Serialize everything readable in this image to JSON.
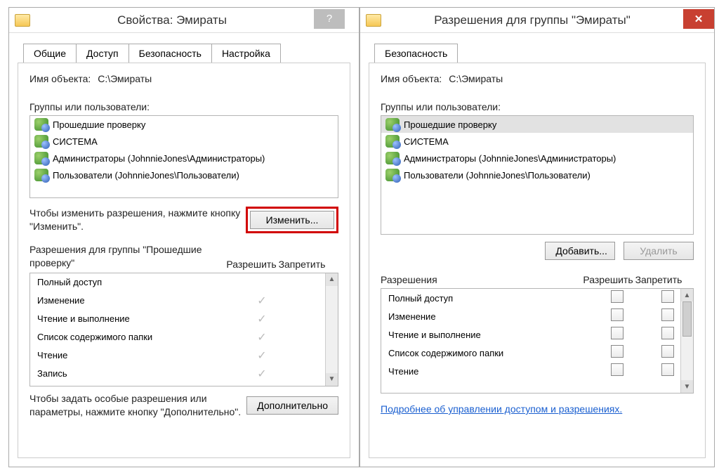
{
  "left": {
    "title": "Свойства: Эмираты",
    "tabs": [
      "Общие",
      "Доступ",
      "Безопасность",
      "Настройка"
    ],
    "active_tab": 2,
    "object_label": "Имя объекта:",
    "object_path": "C:\\Эмираты",
    "groups_label": "Группы или пользователи:",
    "groups": [
      "Прошедшие проверку",
      "СИСТЕМА",
      "Администраторы (JohnnieJones\\Администраторы)",
      "Пользователи (JohnnieJones\\Пользователи)"
    ],
    "change_hint": "Чтобы изменить разрешения, нажмите кнопку \"Изменить\".",
    "change_btn": "Изменить...",
    "perm_header": "Разрешения для группы \"Прошедшие проверку\"",
    "col_allow": "Разрешить",
    "col_deny": "Запретить",
    "perms": [
      {
        "name": "Полный доступ",
        "allow": false
      },
      {
        "name": "Изменение",
        "allow": true
      },
      {
        "name": "Чтение и выполнение",
        "allow": true
      },
      {
        "name": "Список содержимого папки",
        "allow": true
      },
      {
        "name": "Чтение",
        "allow": true
      },
      {
        "name": "Запись",
        "allow": true
      }
    ],
    "adv_hint": "Чтобы задать особые разрешения или параметры, нажмите кнопку \"Дополнительно\".",
    "adv_btn": "Дополнительно"
  },
  "right": {
    "title": "Разрешения для группы \"Эмираты\"",
    "tab": "Безопасность",
    "object_label": "Имя объекта:",
    "object_path": "C:\\Эмираты",
    "groups_label": "Группы или пользователи:",
    "groups": [
      "Прошедшие проверку",
      "СИСТЕМА",
      "Администраторы (JohnnieJones\\Администраторы)",
      "Пользователи (JohnnieJones\\Пользователи)"
    ],
    "add_btn": "Добавить...",
    "remove_btn": "Удалить",
    "perm_header": "Разрешения",
    "col_allow": "Разрешить",
    "col_deny": "Запретить",
    "perms": [
      "Полный доступ",
      "Изменение",
      "Чтение и выполнение",
      "Список содержимого папки",
      "Чтение"
    ],
    "more_link": "Подробнее об управлении доступом и разрешениях."
  }
}
